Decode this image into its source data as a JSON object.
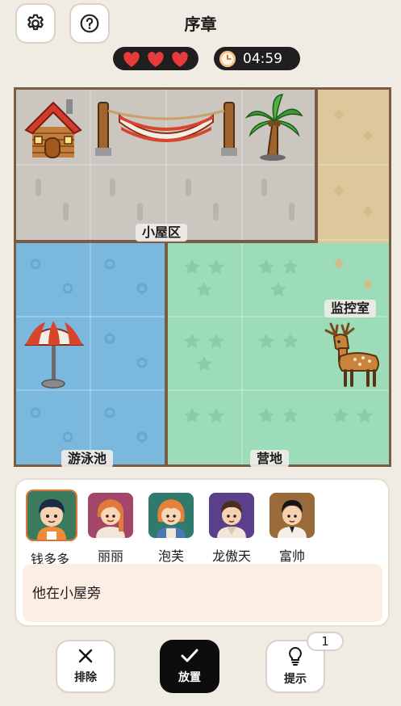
{
  "header": {
    "title": "序章",
    "settings_icon": "gear-icon",
    "help_icon": "question-icon",
    "lives": 3,
    "timer": "04:59"
  },
  "board": {
    "zones": {
      "cabin": "小屋区",
      "monitor": "监控室",
      "pool": "游泳池",
      "camp": "营地"
    },
    "objects": [
      "cabin-house",
      "hammock",
      "palm-tree",
      "beach-umbrella",
      "deer"
    ]
  },
  "characters": [
    {
      "name": "钱多多",
      "selected": true
    },
    {
      "name": "丽丽",
      "selected": false
    },
    {
      "name": "泡芙",
      "selected": false
    },
    {
      "name": "龙傲天",
      "selected": false
    },
    {
      "name": "富帅",
      "selected": false
    }
  ],
  "clue": "他在小屋旁",
  "actions": {
    "remove": "排除",
    "place": "放置",
    "hint": "提示",
    "hint_count": "1"
  },
  "colors": {
    "cabin_zone": "#cbc6c0",
    "monitor_zone": "#ddc89b",
    "pool_zone": "#7ab8de",
    "camp_zone": "#9cdcb8",
    "board_border": "#7a5c44",
    "selected_border": "#e0723a"
  }
}
